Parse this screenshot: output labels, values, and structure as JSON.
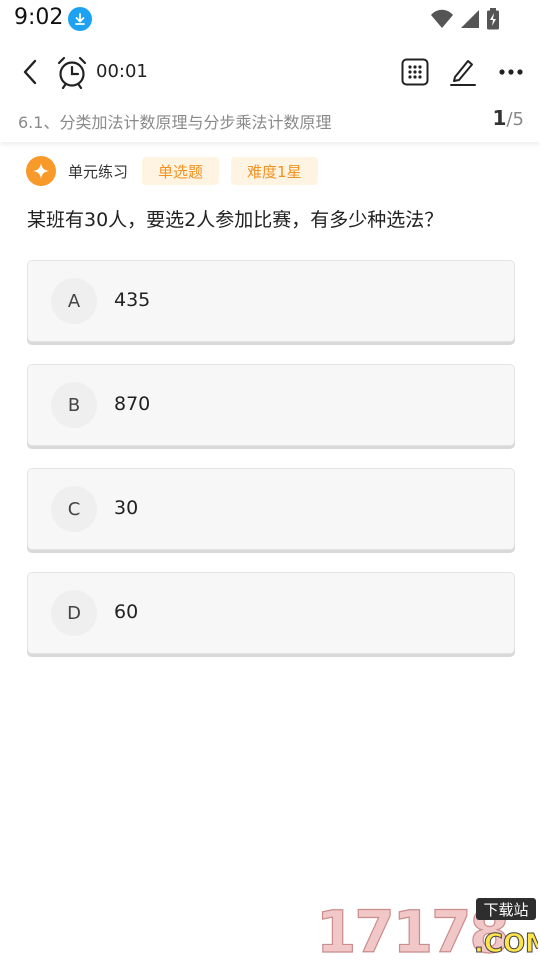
{
  "status_bar": {
    "time": "9:02"
  },
  "toolbar": {
    "timer": "00:01"
  },
  "chapter": {
    "title": "6.1、分类加法计数原理与分步乘法计数原理",
    "current": "1",
    "total": "/5"
  },
  "meta": {
    "unit_label": "单元练习",
    "type_tag": "单选题",
    "difficulty_tag": "难度1星"
  },
  "question": {
    "text": "某班有30人，要选2人参加比赛，有多少种选法？"
  },
  "options": [
    {
      "letter": "A",
      "text": "435"
    },
    {
      "letter": "B",
      "text": "870"
    },
    {
      "letter": "C",
      "text": "30"
    },
    {
      "letter": "D",
      "text": "60"
    }
  ],
  "watermark": {
    "number": "17178",
    "tag": "下载站",
    "suffix": ".COM"
  },
  "colors": {
    "accent": "#f89a2a",
    "tag_bg": "#fff3e2",
    "tag_text": "#f39221",
    "download_badge": "#1da1f2"
  }
}
